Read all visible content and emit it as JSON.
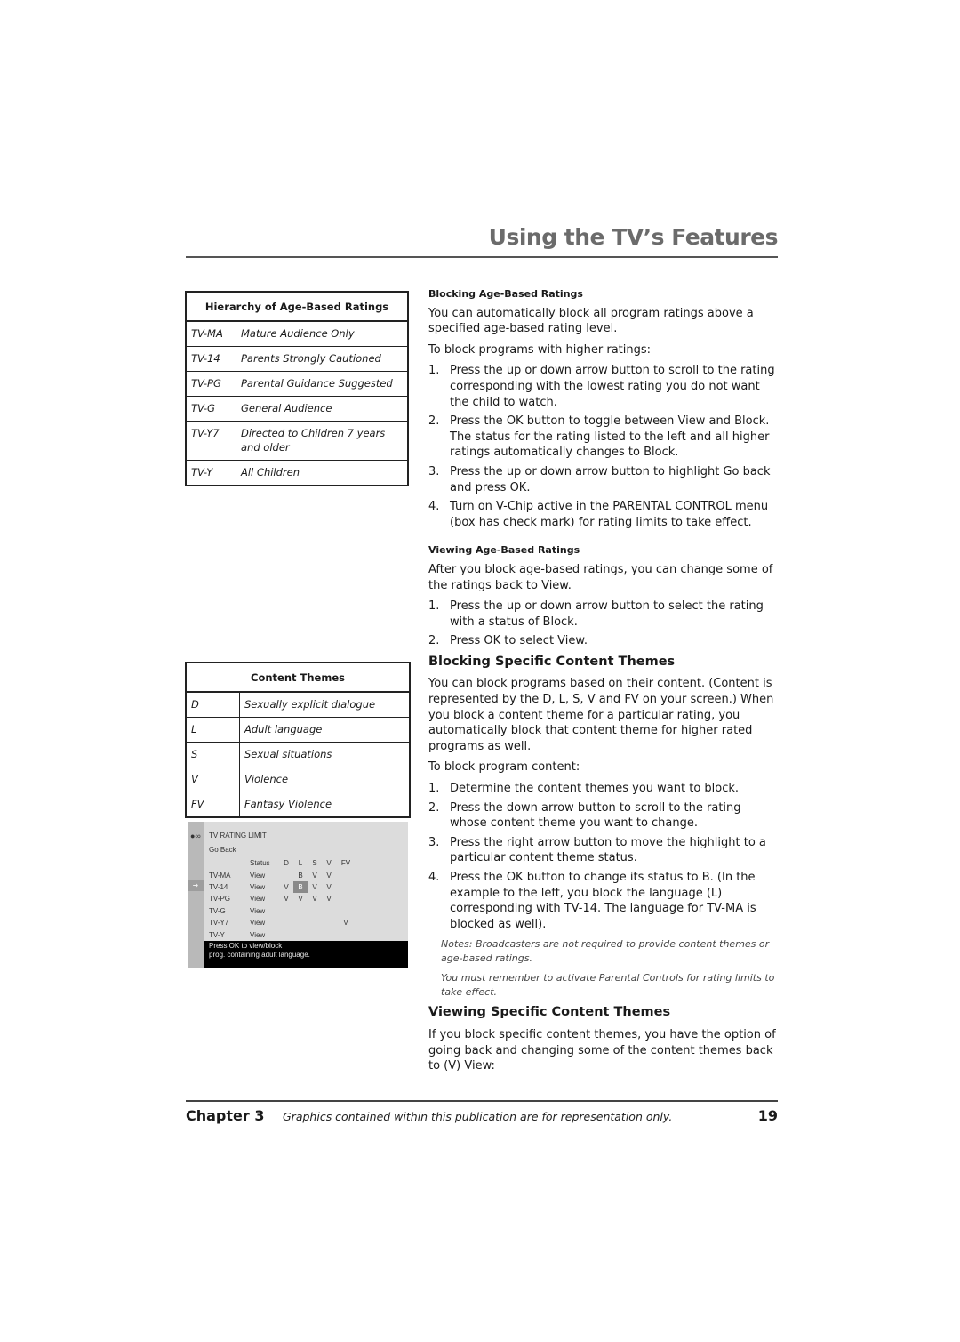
{
  "header": {
    "title": "Using the TV’s Features"
  },
  "ratings_table": {
    "title": "Hierarchy of Age-Based Ratings",
    "rows": [
      {
        "code": "TV-MA",
        "desc": "Mature Audience Only"
      },
      {
        "code": "TV-14",
        "desc": "Parents Strongly Cautioned"
      },
      {
        "code": "TV-PG",
        "desc": "Parental Guidance Suggested"
      },
      {
        "code": "TV-G",
        "desc": "General Audience"
      },
      {
        "code": "TV-Y7",
        "desc": "Directed to Children 7 years and older"
      },
      {
        "code": "TV-Y",
        "desc": "All Children"
      }
    ]
  },
  "themes_table": {
    "title": "Content Themes",
    "rows": [
      {
        "code": "D",
        "desc": "Sexually explicit dialogue"
      },
      {
        "code": "L",
        "desc": "Adult language"
      },
      {
        "code": "S",
        "desc": "Sexual situations"
      },
      {
        "code": "V",
        "desc": "Violence"
      },
      {
        "code": "FV",
        "desc": "Fantasy Violence"
      }
    ]
  },
  "tv_menu": {
    "lock_icon": "lock-icon",
    "arrow_icon": "right-arrow-icon",
    "title": "TV RATING LIMIT",
    "go_back": "Go Back",
    "headers": [
      "",
      "Status",
      "D",
      "L",
      "S",
      "V",
      "FV"
    ],
    "rows": [
      [
        "TV-MA",
        "View",
        "",
        "B",
        "V",
        "V",
        ""
      ],
      [
        "TV-14",
        "View",
        "V",
        "B",
        "V",
        "V",
        ""
      ],
      [
        "TV-PG",
        "View",
        "V",
        "V",
        "V",
        "V",
        ""
      ],
      [
        "TV-G",
        "View",
        "",
        "",
        "",
        "",
        ""
      ],
      [
        "TV-Y7",
        "View",
        "",
        "",
        "",
        "",
        "V"
      ],
      [
        "TV-Y",
        "View",
        "",
        "",
        "",
        "",
        ""
      ]
    ],
    "selected": {
      "row": "TV-14",
      "column": "L"
    },
    "message_line1": "Press OK to view/block",
    "message_line2": "prog. containing adult language."
  },
  "blocking_age": {
    "heading": "Blocking Age-Based Ratings",
    "intro": "You can automatically block all program ratings above a specified age-based rating level.",
    "lead": "To block programs with higher ratings:",
    "steps": [
      "Press the up or down arrow button to scroll to the rating corresponding with the lowest rating you do not want the child to watch.",
      "Press the OK button to toggle between View and Block. The status for the rating listed to the left and all higher ratings automatically changes to Block.",
      "Press the up or down arrow button to highlight Go back and press OK.",
      "Turn on V-Chip active in the PARENTAL CONTROL menu (box has check mark) for rating limits to take effect."
    ]
  },
  "viewing_age": {
    "heading": "Viewing Age-Based Ratings",
    "intro": "After you block age-based ratings, you can change some of the ratings back to View.",
    "steps": [
      "Press the up or down arrow button to select the rating with a status of Block.",
      "Press OK to select View."
    ]
  },
  "blocking_content": {
    "heading": "Blocking Specific Content Themes",
    "intro": "You can block programs based on their content. (Content is represented by the D, L, S, V and FV on your screen.) When you block a content theme for a particular rating, you automatically block that content theme for higher rated programs as well.",
    "lead": "To block program content:",
    "steps": [
      "Determine the content themes you want to block.",
      "Press the down arrow button to scroll to the rating whose content theme you want to change.",
      "Press the right arrow button to move the highlight to a particular content theme status.",
      "Press the OK button to change its status to B. (In the example to the left, you block the language (L) corresponding with TV-14. The language for TV-MA is blocked as well)."
    ],
    "notes": [
      "Notes: Broadcasters are not required to provide content themes or age-based ratings.",
      "You must remember to activate Parental Controls for rating limits to take effect."
    ]
  },
  "viewing_content": {
    "heading": "Viewing Specific Content Themes",
    "intro": "If you block specific content themes, you have the option of going back and changing some of the content themes back to (V) View:"
  },
  "footer": {
    "chapter": "Chapter 3",
    "note": "Graphics contained within this publication are for representation only.",
    "page": "19"
  }
}
